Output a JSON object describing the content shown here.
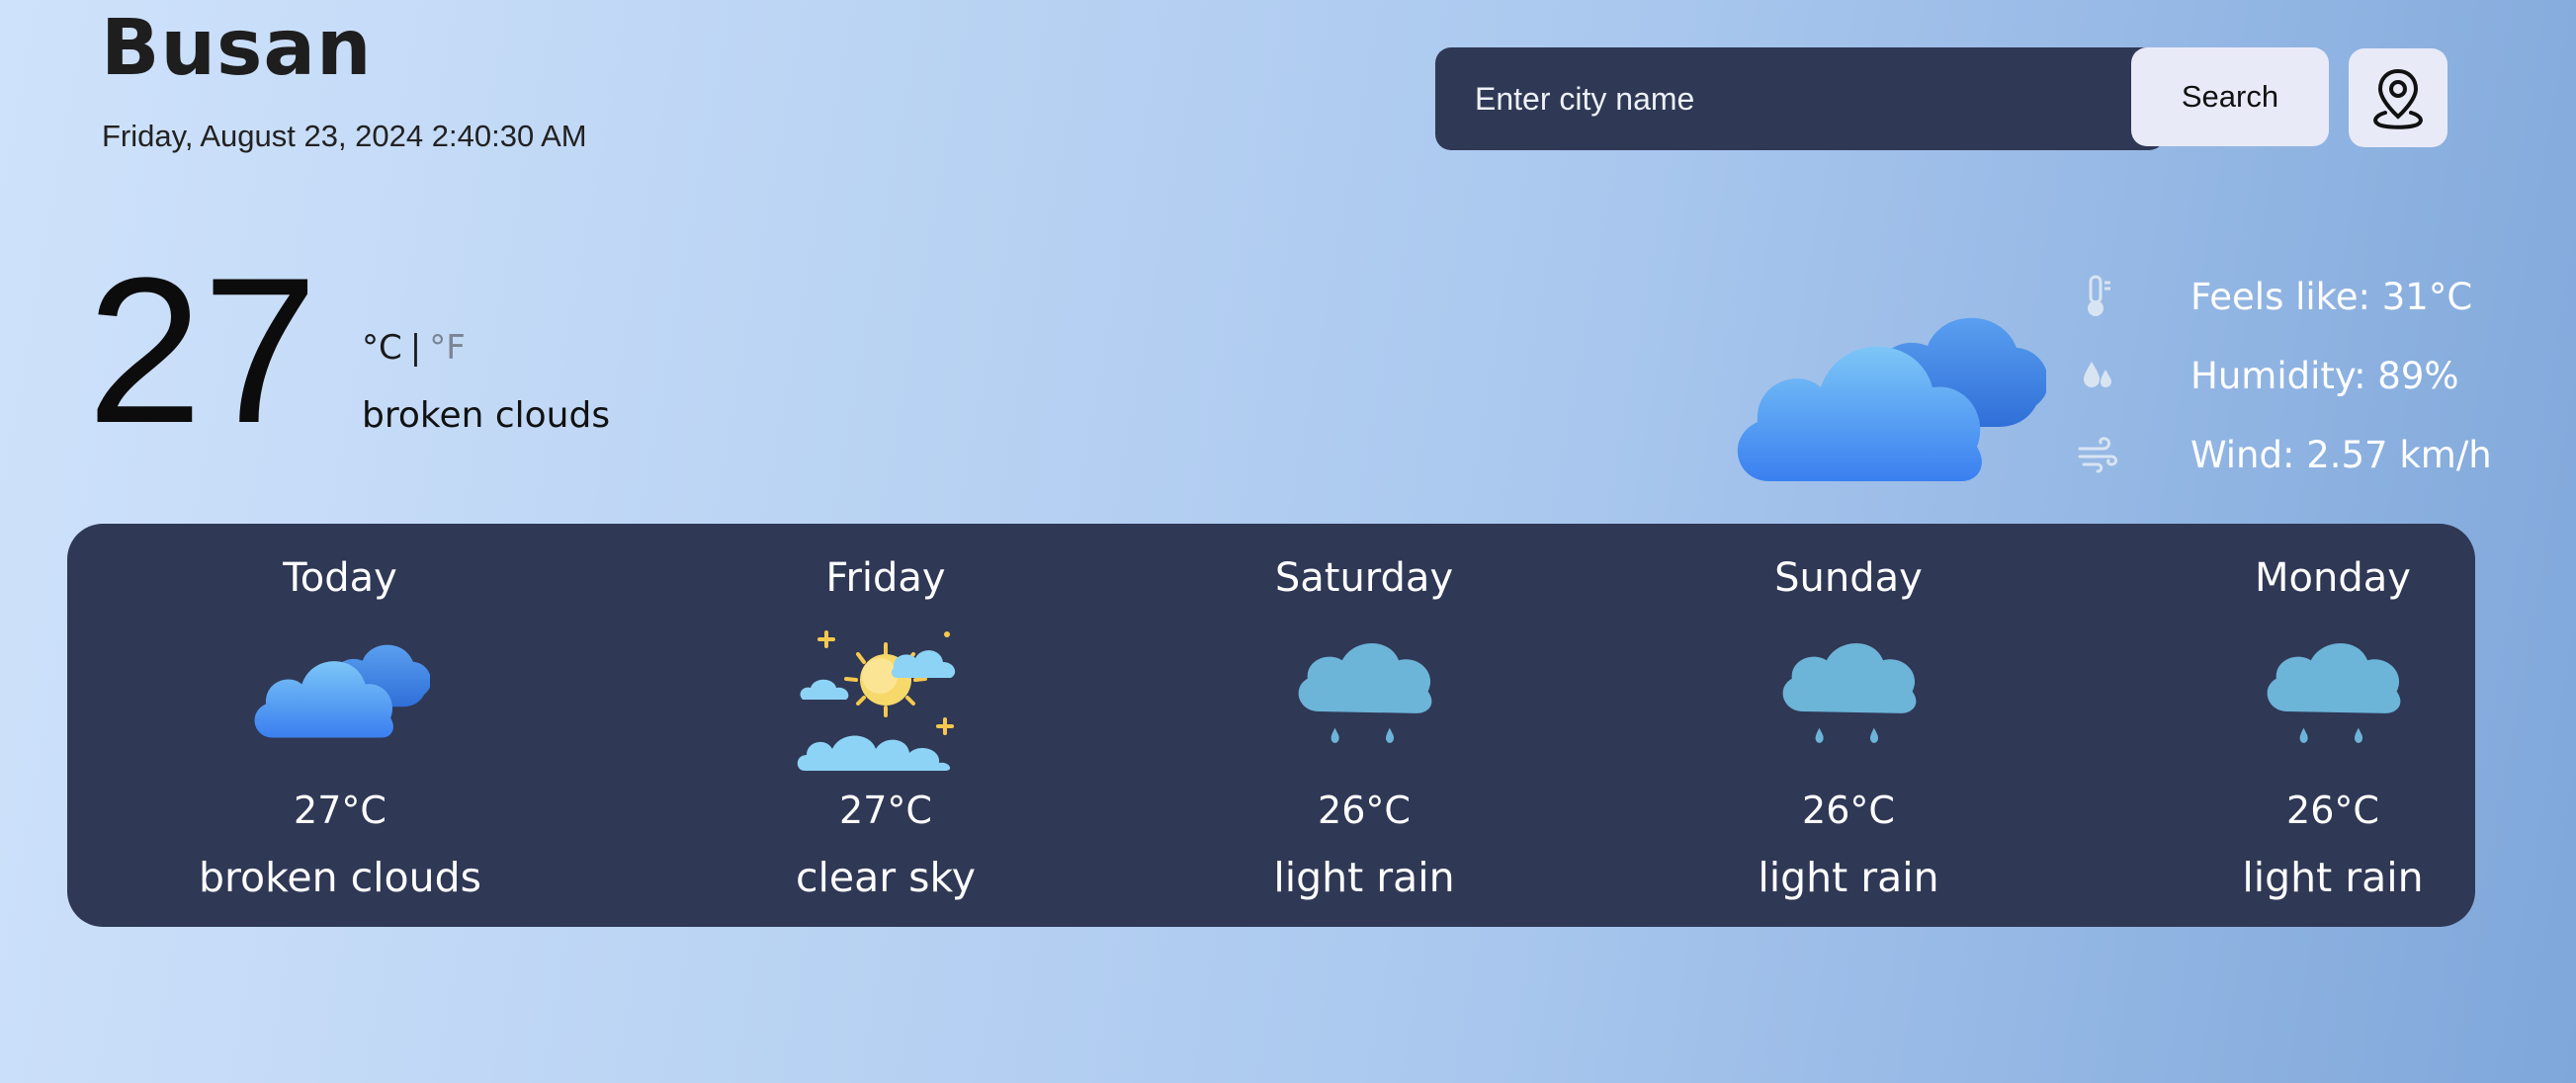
{
  "location": {
    "city": "Busan",
    "datetime": "Friday, August 23, 2024 2:40:30 AM"
  },
  "search": {
    "placeholder": "Enter city name",
    "button_label": "Search",
    "location_icon": "map-pin-icon"
  },
  "current": {
    "temperature": "27",
    "unit_c": "°C",
    "unit_sep": "|",
    "unit_f": "°F",
    "description": "broken clouds",
    "icon": "broken-clouds-icon",
    "details": [
      {
        "icon": "thermometer-icon",
        "label": "Feels like: 31°C"
      },
      {
        "icon": "humidity-icon",
        "label": "Humidity: 89%"
      },
      {
        "icon": "wind-icon",
        "label": "Wind: 2.57 km/h"
      }
    ]
  },
  "forecast": [
    {
      "day": "Today",
      "temp": "27°C",
      "desc": "broken clouds",
      "icon": "broken-clouds-icon"
    },
    {
      "day": "Friday",
      "temp": "27°C",
      "desc": "clear sky",
      "icon": "clear-sky-icon"
    },
    {
      "day": "Saturday",
      "temp": "26°C",
      "desc": "light rain",
      "icon": "light-rain-icon"
    },
    {
      "day": "Sunday",
      "temp": "26°C",
      "desc": "light rain",
      "icon": "light-rain-icon"
    },
    {
      "day": "Monday",
      "temp": "26°C",
      "desc": "light rain",
      "icon": "light-rain-icon"
    }
  ],
  "colors": {
    "panel": "#2f3855",
    "button": "#e9eaf8",
    "cloud_light": "#6fb8f4",
    "cloud_dark": "#3b7fe8",
    "rain_cloud": "#6db6d9",
    "sun": "#f7d96b"
  }
}
